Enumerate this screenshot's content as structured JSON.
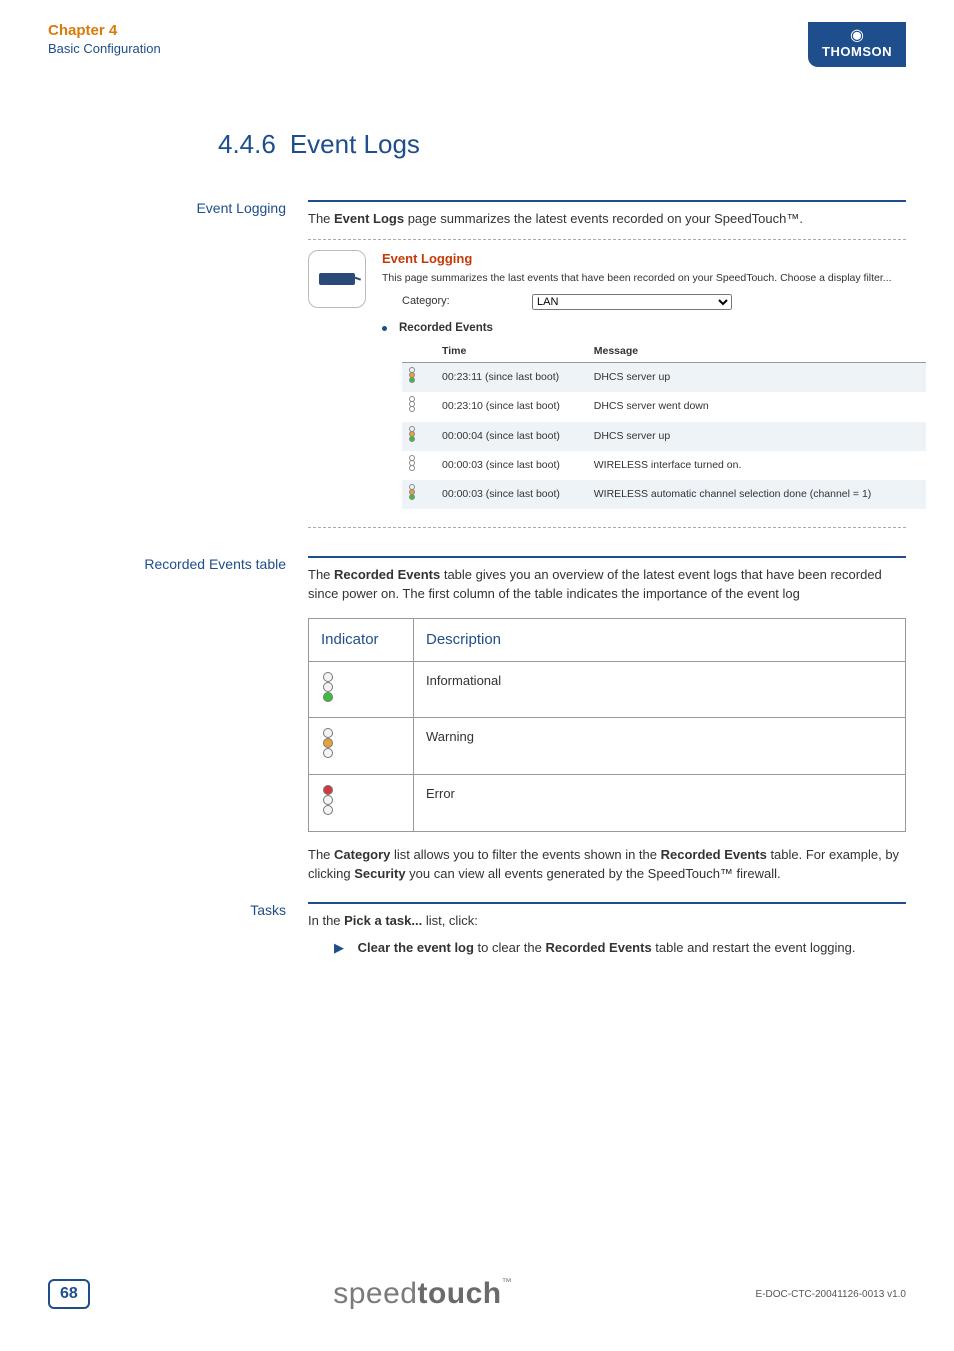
{
  "header": {
    "chapter": "Chapter 4",
    "subtitle": "Basic Configuration",
    "brand": "THOMSON"
  },
  "section": {
    "number": "4.4.6",
    "title": "Event Logs"
  },
  "eventLogging": {
    "sideLabel": "Event Logging",
    "intro_pre": "The ",
    "intro_bold": "Event Logs",
    "intro_post": " page summarizes the latest events recorded on your SpeedTouch™.",
    "shot": {
      "title": "Event Logging",
      "desc": "This page summarizes the last events that have been recorded on your SpeedTouch. Choose a display filter...",
      "categoryLabel": "Category:",
      "categoryValue": "LAN",
      "tableTitle": "Recorded Events",
      "cols": {
        "time": "Time",
        "message": "Message"
      },
      "rows": [
        {
          "level": "info",
          "time": "00:23:11 (since last boot)",
          "msg": "DHCS server up"
        },
        {
          "level": "plain",
          "time": "00:23:10 (since last boot)",
          "msg": "DHCS server went down"
        },
        {
          "level": "info",
          "time": "00:00:04 (since last boot)",
          "msg": "DHCS server up"
        },
        {
          "level": "plain",
          "time": "00:00:03 (since last boot)",
          "msg": "WIRELESS interface turned on."
        },
        {
          "level": "info",
          "time": "00:00:03 (since last boot)",
          "msg": "WIRELESS automatic channel selection done (channel = 1)"
        }
      ]
    }
  },
  "recorded": {
    "sideLabel": "Recorded Events table",
    "intro": {
      "p1": "The ",
      "b1": "Recorded Events",
      "p2": " table gives you an overview of the latest event logs that have been recorded since power on. The first column of the table indicates the importance of the event log"
    },
    "table": {
      "head": {
        "c1": "Indicator",
        "c2": "Description"
      },
      "rows": [
        {
          "kind": "info",
          "desc": "Informational"
        },
        {
          "kind": "warn",
          "desc": "Warning"
        },
        {
          "kind": "err",
          "desc": "Error"
        }
      ]
    },
    "after": {
      "p1": "The ",
      "b1": "Category",
      "p2": " list allows you to filter the events shown in the ",
      "b2": "Recorded Events",
      "p3": " table. For example, by clicking ",
      "b3": "Security",
      "p4": " you can view all events generated by the SpeedTouch™ firewall."
    }
  },
  "tasks": {
    "sideLabel": "Tasks",
    "intro": {
      "p1": "In the ",
      "b1": "Pick a task...",
      "p2": " list, click:"
    },
    "item": {
      "b1": "Clear the event log",
      "p1": " to clear the ",
      "b2": "Recorded Events",
      "p2": " table and restart the event logging."
    }
  },
  "footer": {
    "page": "68",
    "brand_a": "speed",
    "brand_b": "touch",
    "tm": "™",
    "docid": "E-DOC-CTC-20041126-0013 v1.0"
  }
}
